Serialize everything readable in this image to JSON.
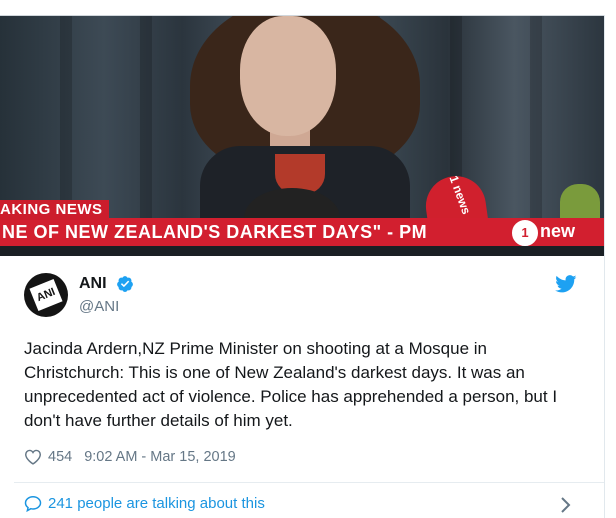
{
  "media": {
    "breaking_label": "AKING NEWS",
    "headline": "NE OF NEW ZEALAND'S DARKEST DAYS\" - PM",
    "channel_number": "1",
    "channel_text": "new",
    "mic_text": "1 news"
  },
  "tweet": {
    "author_name": "ANI",
    "author_handle": "@ANI",
    "avatar_text": "ANI",
    "text": "Jacinda Ardern,NZ Prime Minister on shooting at a Mosque in Christchurch: This is one of New Zealand's darkest days. It was an unprecedented act of violence. Police has apprehended a person, but I don't have further details of him yet.",
    "likes": "454",
    "timestamp": "9:02 AM - Mar 15, 2019",
    "talking_about": "241 people are talking about this"
  },
  "colors": {
    "accent": "#1da1f2",
    "link": "#1b95e0",
    "ticker_red": "#d21f2f"
  }
}
